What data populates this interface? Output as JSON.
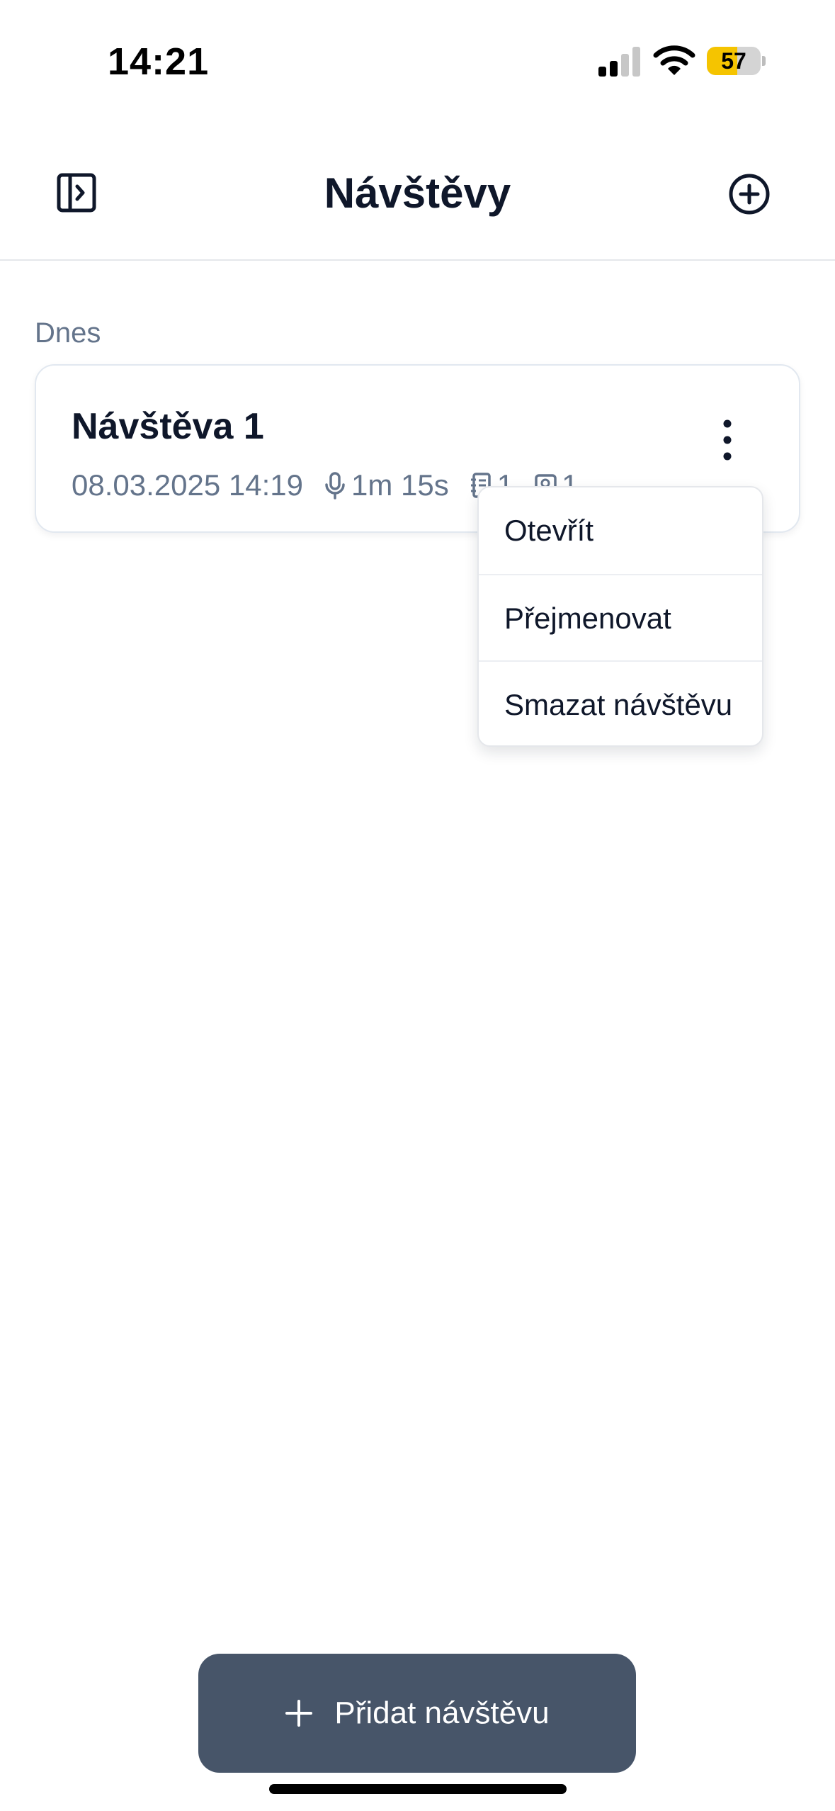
{
  "status_bar": {
    "time": "14:21",
    "battery_percent": "57",
    "battery_level": 0.57,
    "signal_bars_active": 2,
    "signal_bars_total": 4
  },
  "header": {
    "title": "Návštěvy",
    "left_icon": "sidebar-toggle-icon",
    "right_icon": "plus-circle-icon"
  },
  "sections": [
    {
      "label": "Dnes",
      "visits": [
        {
          "title": "Návštěva 1",
          "datetime": "08.03.2025 14:19",
          "duration": "1m 15s",
          "notes_count": "1",
          "photos_count": "1"
        }
      ]
    }
  ],
  "context_menu": {
    "items": [
      "Otevřít",
      "Přejmenovat",
      "Smazat návštěvu"
    ]
  },
  "bottom_button": {
    "label": "Přidat návštěvu",
    "icon": "plus-icon"
  },
  "colors": {
    "title": "#0f172a",
    "muted": "#64748b",
    "button_bg": "#475569",
    "battery_accent": "#f5c400"
  }
}
